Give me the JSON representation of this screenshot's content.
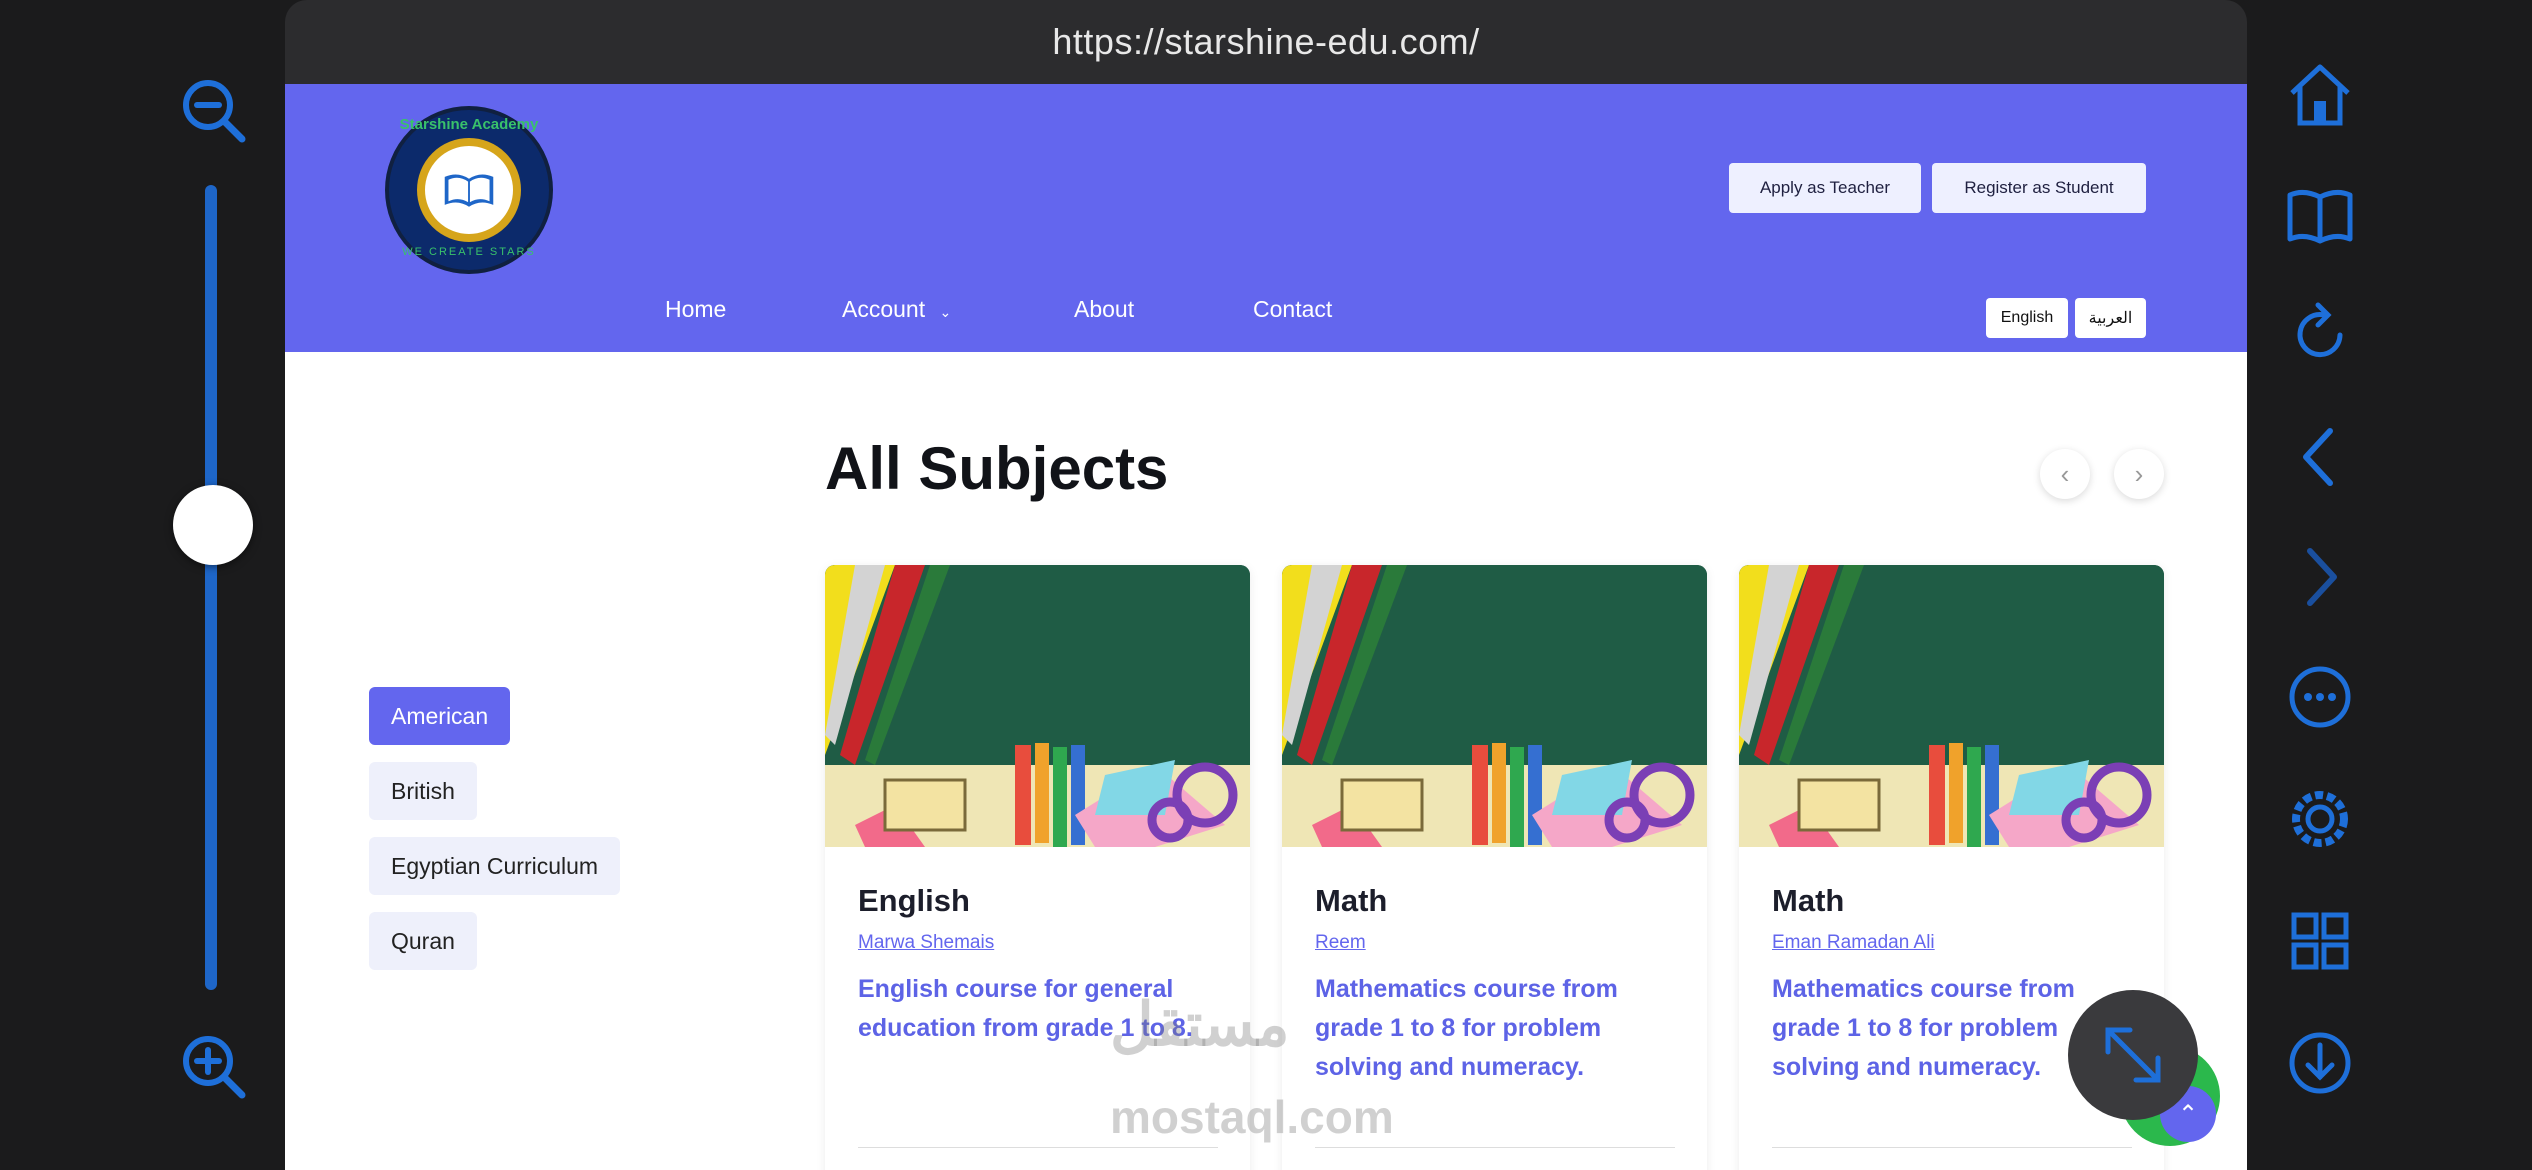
{
  "browser": {
    "url": "https://starshine-edu.com/"
  },
  "header": {
    "logo_text_top": "Starshine Academy",
    "logo_text_bottom": "WE CREATE STARS",
    "apply_teacher": "Apply as Teacher",
    "register_student": "Register as Student",
    "nav": [
      {
        "label": "Home"
      },
      {
        "label": "Account"
      },
      {
        "label": "About"
      },
      {
        "label": "Contact"
      }
    ],
    "lang_english": "English",
    "lang_arabic": "العربية"
  },
  "filters": [
    {
      "label": "American",
      "active": true
    },
    {
      "label": "British",
      "active": false
    },
    {
      "label": "Egyptian Curriculum",
      "active": false
    },
    {
      "label": "Quran",
      "active": false
    }
  ],
  "section": {
    "title": "All Subjects",
    "prev_icon": "chevron-left-icon",
    "next_icon": "chevron-right-icon"
  },
  "cards": [
    {
      "title": "English",
      "teacher": "Marwa Shemais",
      "description": "English course for general education from grade 1 to 8."
    },
    {
      "title": "Math",
      "teacher": "Reem",
      "description": "Mathematics course from grade 1 to 8 for problem solving and numeracy."
    },
    {
      "title": "Math",
      "teacher": "Eman Ramadan Ali",
      "description": "Mathematics course from grade 1 to 8 for problem solving and numeracy."
    }
  ],
  "watermark": {
    "arabic": "مستقل",
    "latin": "mostaql.com"
  },
  "zoom": {
    "level": 0.42
  },
  "colors": {
    "accent": "#6366ee",
    "toolbar_blue": "#1e6fd9",
    "whatsapp_green": "#2bb84c"
  },
  "toolbar_icons": [
    "home-icon",
    "book-icon",
    "reload-icon",
    "back-icon",
    "forward-icon",
    "more-icon",
    "settings-icon",
    "grid-icon",
    "download-icon"
  ]
}
